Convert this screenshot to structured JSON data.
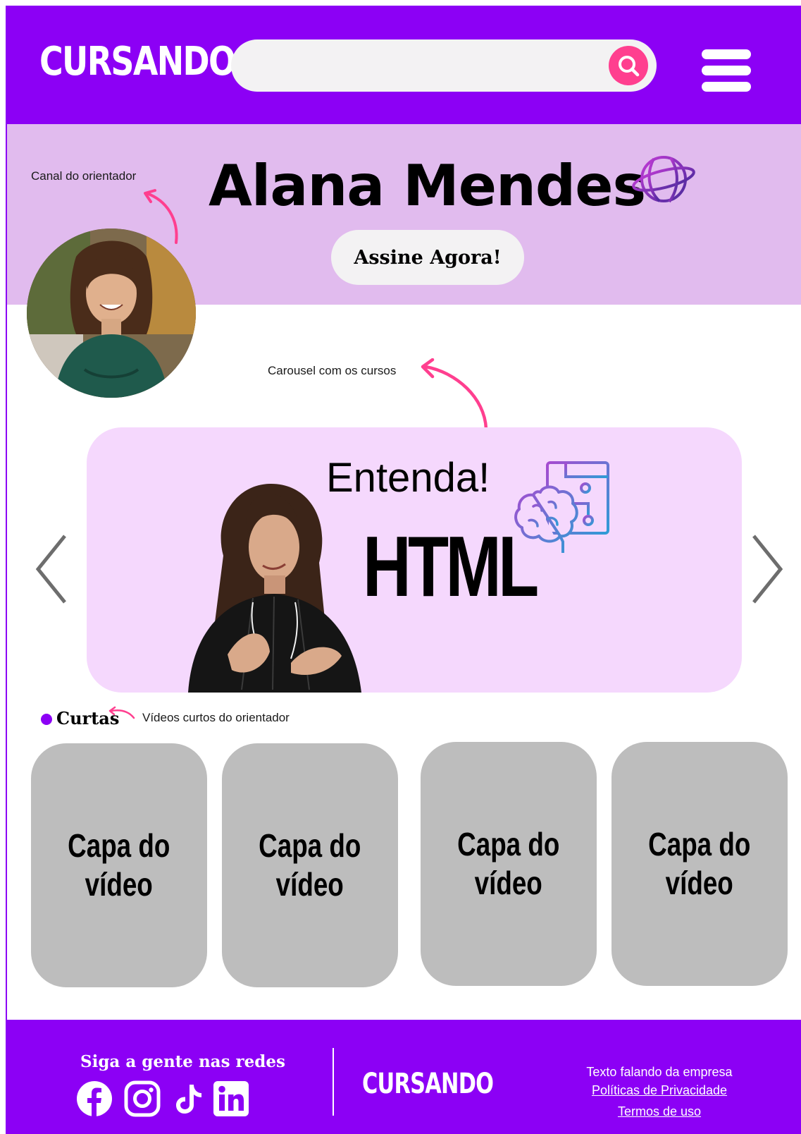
{
  "header": {
    "logo": "CURSANDO",
    "search_placeholder": ""
  },
  "profile": {
    "name": "Alana Mendes",
    "subscribe_label": "Assine Agora!",
    "note_channel": "Canal do orientador"
  },
  "carousel": {
    "note": "Carousel com os cursos",
    "heading": "Entenda!",
    "topic": "HTML"
  },
  "shorts": {
    "title": "Curtas",
    "note": "Vídeos curtos do orientador",
    "cards": [
      {
        "line1": "Capa do",
        "line2": "vídeo"
      },
      {
        "line1": "Capa do",
        "line2": "vídeo"
      },
      {
        "line1": "Capa do",
        "line2": "vídeo"
      },
      {
        "line1": "Capa do",
        "line2": "vídeo"
      }
    ]
  },
  "footer": {
    "social_title": "Siga a gente nas redes",
    "logo": "CURSANDO",
    "company_text": "Texto falando da empresa",
    "privacy_link": "Políticas de Privacidade",
    "terms_link": "Termos de uso"
  },
  "colors": {
    "brand_purple": "#8c00f5",
    "accent_pink": "#ff3f8f",
    "band_lilac": "#e1bbee",
    "carousel_pink": "#f5d8fd",
    "card_gray": "#bdbdbd"
  },
  "icons": [
    "search-icon",
    "menu-icon",
    "globe-icon",
    "brain-circuit-icon",
    "chevron-left-icon",
    "chevron-right-icon",
    "facebook-icon",
    "instagram-icon",
    "tiktok-icon",
    "linkedin-icon"
  ]
}
